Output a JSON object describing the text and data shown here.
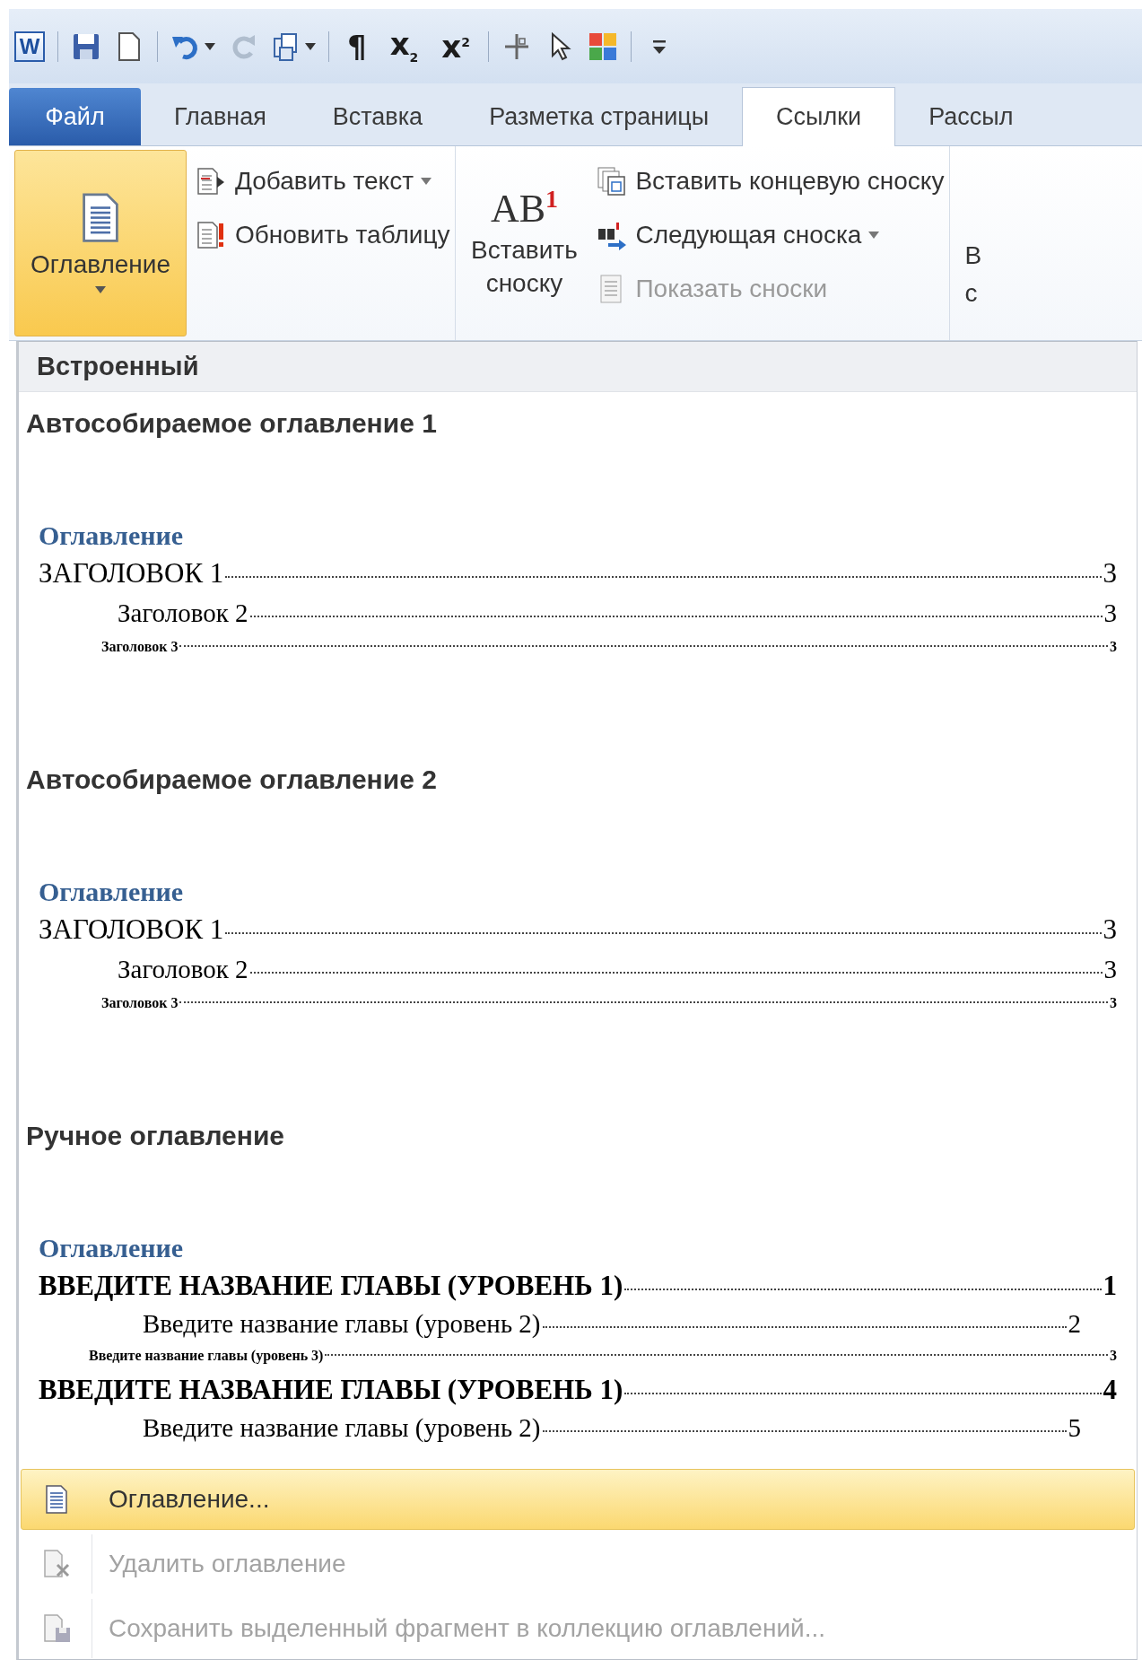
{
  "quick_access": [
    {
      "kind": "logo",
      "text": "W",
      "dropdown": false,
      "disabled": false
    },
    {
      "kind": "separator"
    },
    {
      "kind": "save",
      "dropdown": false,
      "disabled": false
    },
    {
      "kind": "new",
      "dropdown": false,
      "disabled": false
    },
    {
      "kind": "separator"
    },
    {
      "kind": "undo",
      "dropdown": true,
      "disabled": false
    },
    {
      "kind": "redo",
      "dropdown": false,
      "disabled": true
    },
    {
      "kind": "copy",
      "dropdown": true,
      "disabled": false
    },
    {
      "kind": "separator"
    },
    {
      "kind": "glyph",
      "text": "¶",
      "dropdown": false,
      "disabled": false
    },
    {
      "kind": "glyph",
      "text": "x$_{2}$",
      "dropdown": false,
      "disabled": false
    },
    {
      "kind": "glyph",
      "text": "x$^{2}$",
      "dropdown": false,
      "disabled": false
    },
    {
      "kind": "separator"
    },
    {
      "kind": "cross",
      "dropdown": false,
      "disabled": false
    },
    {
      "kind": "pointer",
      "dropdown": false,
      "disabled": false
    },
    {
      "kind": "tiles",
      "dropdown": false,
      "disabled": false
    },
    {
      "kind": "separator"
    },
    {
      "kind": "customize",
      "dropdown": false,
      "disabled": false
    }
  ],
  "tabs": [
    {
      "label": "Файл",
      "kind": "file",
      "selected": false
    },
    {
      "label": "Главная",
      "kind": "tab",
      "selected": false
    },
    {
      "label": "Вставка",
      "kind": "tab",
      "selected": false
    },
    {
      "label": "Разметка страницы",
      "kind": "tab",
      "selected": false
    },
    {
      "label": "Ссылки",
      "kind": "tab",
      "selected": true
    },
    {
      "label": "Рассыл",
      "kind": "tab",
      "selected": false
    }
  ],
  "ribbon": {
    "groups": [
      {
        "big": {
          "kind": "toc",
          "label": "Оглавление",
          "pressed": true,
          "dropdown": true
        },
        "small": [
          {
            "kind": "add-text",
            "label": "Добавить текст",
            "dropdown": true,
            "disabled": false
          },
          {
            "kind": "update-table",
            "label": "Обновить таблицу",
            "dropdown": false,
            "disabled": false
          }
        ]
      },
      {
        "big": {
          "kind": "footnote",
          "glyph": "AB$^{1}$",
          "label": "Вставить сноску",
          "pressed": false,
          "dropdown": false
        },
        "small": [
          {
            "kind": "endnote",
            "label": "Вставить концевую сноску",
            "dropdown": false,
            "disabled": false
          },
          {
            "kind": "next-footnote",
            "label": "Следующая сноска",
            "dropdown": true,
            "disabled": false
          },
          {
            "kind": "show-notes",
            "label": "Показать сноски",
            "dropdown": false,
            "disabled": true
          }
        ]
      }
    ],
    "cut_group": [
      "В",
      "с"
    ]
  },
  "panel": {
    "header": "Встроенный",
    "gallery": [
      {
        "kind": "auto",
        "title": "Автособираемое оглавление 1",
        "preview": {
          "heading": "Оглавление",
          "entries": [
            {
              "text": "ЗАГОЛОВОК 1",
              "page": "3",
              "children": [
                {
                  "text": "Заголовок 2",
                  "page": "3",
                  "children": [
                    {
                      "text": "Заголовок 3",
                      "page": "3"
                    }
                  ]
                }
              ]
            }
          ]
        }
      },
      {
        "kind": "auto",
        "title": "Автособираемое оглавление 2",
        "preview": {
          "heading": "Оглавление",
          "entries": [
            {
              "text": "ЗАГОЛОВОК 1",
              "page": "3",
              "children": [
                {
                  "text": "Заголовок 2",
                  "page": "3",
                  "children": [
                    {
                      "text": "Заголовок 3",
                      "page": "3"
                    }
                  ]
                }
              ]
            }
          ]
        }
      },
      {
        "kind": "manual",
        "title": "Ручное оглавление",
        "preview": {
          "heading": "Оглавление",
          "entries": [
            {
              "text": "ВВЕДИТЕ НАЗВАНИЕ ГЛАВЫ (УРОВЕНЬ 1)",
              "page": "1",
              "children": [
                {
                  "text": "Введите название главы (уровень 2)",
                  "page": "2",
                  "children": [
                    {
                      "text": "Введите название главы (уровень 3)",
                      "page": "3"
                    }
                  ]
                }
              ]
            },
            {
              "text": "ВВЕДИТЕ НАЗВАНИЕ ГЛАВЫ (УРОВЕНЬ 1)",
              "page": "4",
              "children": [
                {
                  "text": "Введите название главы (уровень 2)",
                  "page": "5"
                }
              ]
            }
          ]
        }
      }
    ],
    "menu": [
      {
        "kind": "toc",
        "label": "Оглавление...",
        "selected": true,
        "disabled": false
      },
      {
        "kind": "remove",
        "label": "Удалить оглавление",
        "selected": false,
        "disabled": true
      },
      {
        "kind": "save",
        "label": "Сохранить выделенный фрагмент в коллекцию оглавлений...",
        "selected": false,
        "disabled": true
      }
    ]
  }
}
